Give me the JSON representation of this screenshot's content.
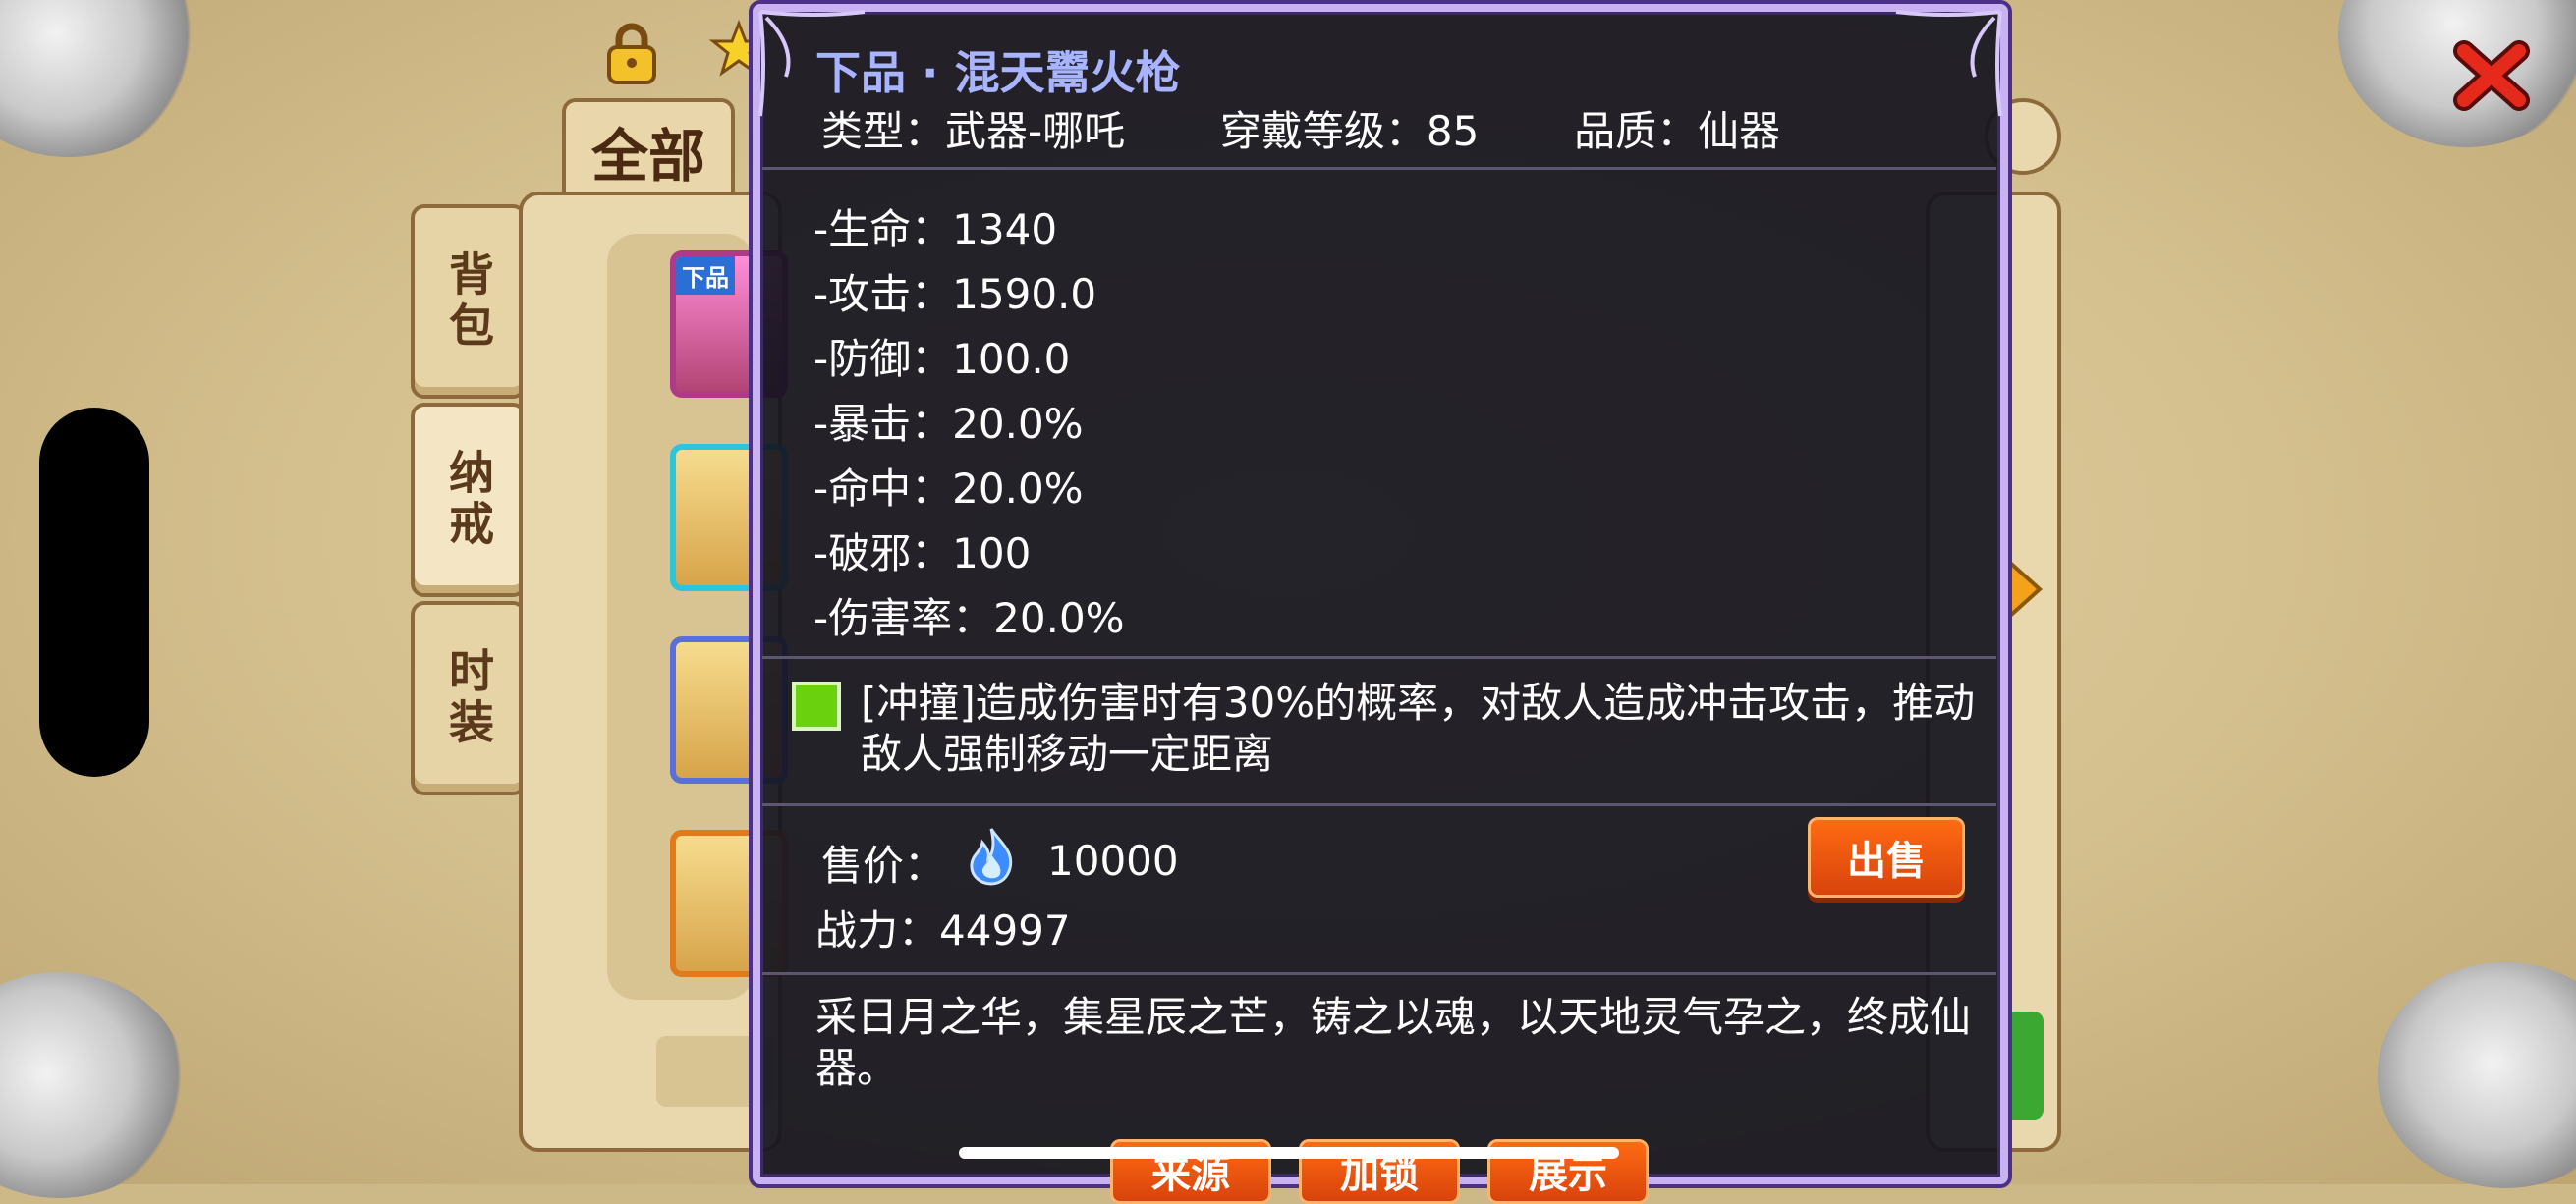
{
  "top_tabs": {
    "all": "全部"
  },
  "side_tabs": {
    "bag": "背包",
    "ring": "纳戒",
    "fashion": "时装"
  },
  "inventory": {
    "slot1_badge": "下品"
  },
  "item": {
    "grade": "下品",
    "separator": "·",
    "name": "混天鬻火枪",
    "type_label": "类型：",
    "type_value": "武器-哪吒",
    "level_label": "穿戴等级：",
    "level_value": "85",
    "quality_label": "品质：",
    "quality_value": "仙器",
    "stats": [
      {
        "label": "-生命：",
        "value": "1340"
      },
      {
        "label": "-攻击：",
        "value": "1590.0"
      },
      {
        "label": "-防御：",
        "value": "100.0"
      },
      {
        "label": "-暴击：",
        "value": "20.0%"
      },
      {
        "label": "-命中：",
        "value": "20.0%"
      },
      {
        "label": "-破邪：",
        "value": "100"
      },
      {
        "label": "-伤害率：",
        "value": "20.0%"
      }
    ],
    "effect": "[冲撞]造成伤害时有30%的概率，对敌人造成冲击攻击，推动敌人强制移动一定距离",
    "price_label": "售价：",
    "price_value": "10000",
    "power_label": "战力：",
    "power_value": "44997",
    "sell_button": "出售",
    "description": "采日月之华，集星辰之芒，铸之以魂，以天地灵气孕之，终成仙器。",
    "buttons": {
      "source": "来源",
      "lock": "加锁",
      "show": "展示"
    }
  },
  "colors": {
    "title": "#a8b4ff",
    "tooltip_border": "#c9b2f2",
    "sell_button": "#e8530f",
    "effect_square": "#6ad10f"
  },
  "icons": [
    "lock-icon",
    "star-icon",
    "close-icon",
    "flame-icon",
    "arrow-right-icon",
    "search-icon"
  ]
}
